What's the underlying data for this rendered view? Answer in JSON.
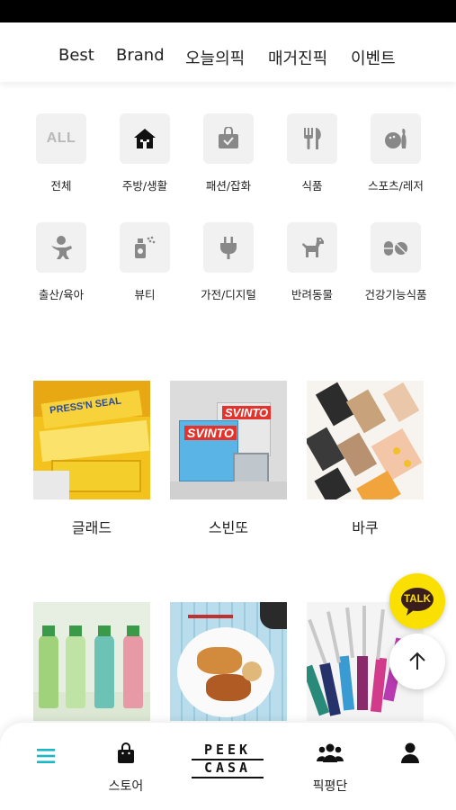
{
  "top_nav": {
    "tabs": [
      "Best",
      "Brand",
      "오늘의픽",
      "매거진픽",
      "이벤트"
    ]
  },
  "categories": [
    {
      "label": "전체",
      "icon": "all-icon",
      "icon_text": "ALL"
    },
    {
      "label": "주방/생활",
      "icon": "house-icon"
    },
    {
      "label": "패션/잡화",
      "icon": "shopping-bag-icon"
    },
    {
      "label": "식품",
      "icon": "fork-knife-icon"
    },
    {
      "label": "스포츠/레저",
      "icon": "bowling-icon"
    },
    {
      "label": "출산/육아",
      "icon": "baby-icon"
    },
    {
      "label": "뷰티",
      "icon": "spray-bottle-icon"
    },
    {
      "label": "가전/디지털",
      "icon": "plug-icon"
    },
    {
      "label": "반려동물",
      "icon": "dog-icon"
    },
    {
      "label": "건강기능식품",
      "icon": "pill-icon"
    }
  ],
  "brands": [
    {
      "name": "글래드",
      "image_text": "PRESS'N SEAL"
    },
    {
      "name": "스빈또",
      "image_text": "SVINTO"
    },
    {
      "name": "바쿠",
      "image_text": ""
    },
    {
      "name": "",
      "image_text": ""
    },
    {
      "name": "",
      "image_text": ""
    },
    {
      "name": "",
      "image_text": ""
    }
  ],
  "floating": {
    "kakao_label": "TALK"
  },
  "bottom_nav": {
    "store_label": "스토어",
    "logo_line1": "PEEK",
    "logo_line2": "CASA",
    "review_label": "픽평단"
  },
  "colors": {
    "accent": "#1bb7c4",
    "kakao": "#f9e000"
  }
}
